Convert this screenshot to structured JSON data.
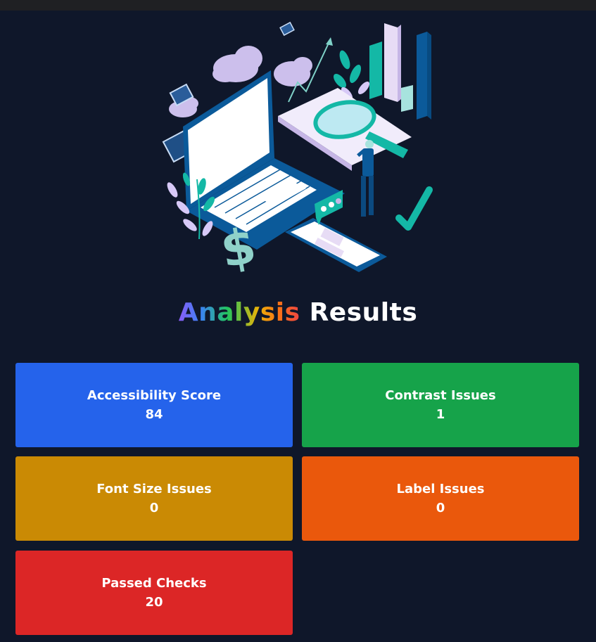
{
  "heading": {
    "part1": "Analysis",
    "part2": "Results"
  },
  "hero": {
    "illustration": "data-analysis-illustration"
  },
  "cards": [
    {
      "label": "Accessibility Score",
      "value": "84",
      "color": "#2563eb"
    },
    {
      "label": "Contrast Issues",
      "value": "1",
      "color": "#16a34a"
    },
    {
      "label": "Font Size Issues",
      "value": "0",
      "color": "#ca8a04"
    },
    {
      "label": "Label Issues",
      "value": "0",
      "color": "#ea580c"
    },
    {
      "label": "Passed Checks",
      "value": "20",
      "color": "#dc2626"
    }
  ],
  "colors": {
    "background": "#0f172a",
    "topbar": "#1f2023"
  }
}
